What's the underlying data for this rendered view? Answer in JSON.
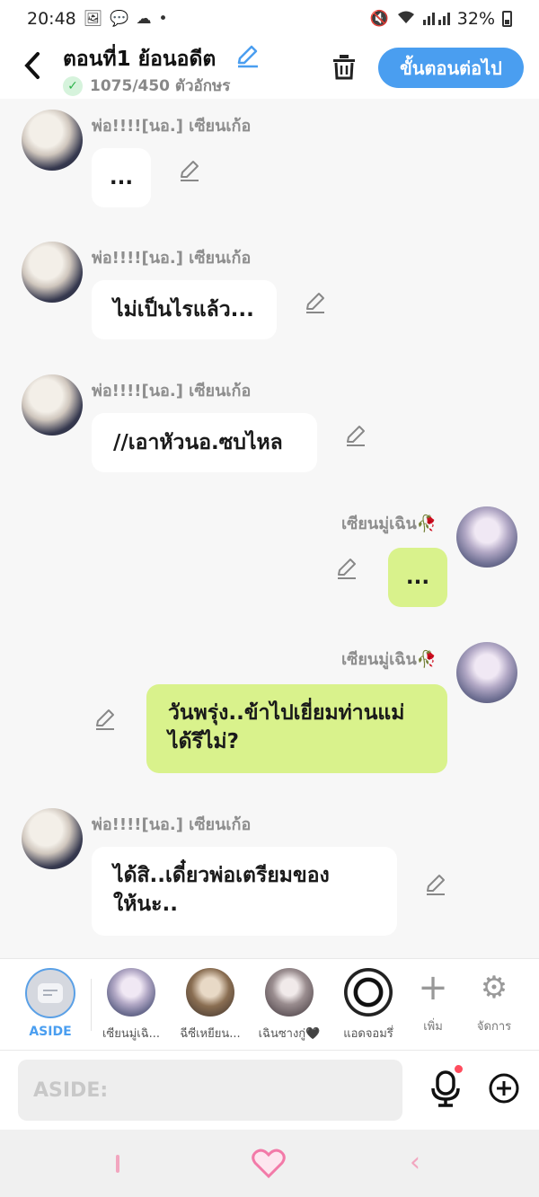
{
  "status_bar": {
    "time": "20:48",
    "battery": "32%",
    "dot": "•"
  },
  "header": {
    "back_icon": "chevron-left-icon",
    "title": "ตอนที่1 ย้อนอดีต",
    "counter": "1075/450 ตัวอักษร",
    "next_label": "ขั้นตอนต่อไป"
  },
  "messages": [
    {
      "speaker": "พ่อ!!!![นอ.] เซียนเก้อ",
      "text": "...",
      "side": "left"
    },
    {
      "speaker": "พ่อ!!!![นอ.] เซียนเก้อ",
      "text": "ไม่เป็นไรแล้ว...",
      "side": "left"
    },
    {
      "speaker": "พ่อ!!!![นอ.] เซียนเก้อ",
      "text": "//เอาหัวนอ.ซบไหล",
      "side": "left"
    },
    {
      "speaker": "เซียนมู่เฉิน🥀",
      "text": "...",
      "side": "right"
    },
    {
      "speaker": "เซียนมู่เฉิน🥀",
      "text_line1": "วันพรุ่ง..ข้าไปเยี่ยมท่านแม่",
      "text_line2": "ได้รึไม่?",
      "side": "right"
    },
    {
      "speaker": "พ่อ!!!![นอ.] เซียนเก้อ",
      "text_line1": "ได้สิ..เดี๋ยวพ่อเตรียมของ",
      "text_line2": "ให้นะ..",
      "side": "left"
    }
  ],
  "characters": {
    "aside_label": "ASIDE",
    "items": [
      {
        "label": "เซียนมู่เฉิ..."
      },
      {
        "label": "ฉีซีเหยียน..."
      },
      {
        "label": "เฉินซางกู่🖤"
      },
      {
        "label": "แอดจอมรึ่"
      }
    ],
    "add_label": "เพิ่ม",
    "manage_label": "จัดการ"
  },
  "input": {
    "placeholder": "ASIDE:"
  },
  "colors": {
    "accent": "#4a9ef0",
    "bubble_green": "#d9f28c",
    "nav_pink": "#f2a6bf"
  }
}
